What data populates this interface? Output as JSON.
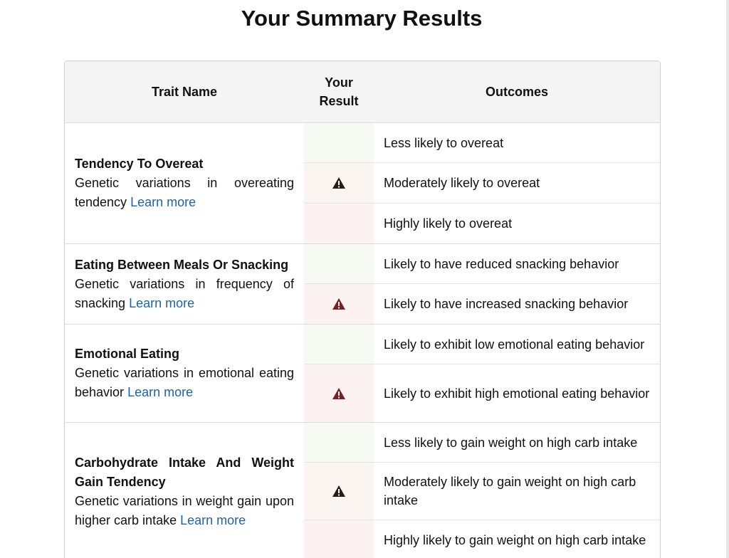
{
  "page_title": "Your Summary Results",
  "columns": {
    "trait": "Trait Name",
    "result_line1": "Your",
    "result_line2": "Result",
    "outcomes": "Outcomes"
  },
  "learn_more_label": "Learn more",
  "colors": {
    "warning_dark": "#2b1a0e",
    "warning_red": "#7a1f1f",
    "link": "#1f63a8"
  },
  "traits": [
    {
      "name": "Tendency To Overeat",
      "description": "Genetic variations in overeating tendency",
      "outcomes": [
        {
          "text": "Less likely to overeat",
          "marked": false
        },
        {
          "text": "Moderately likely to overeat",
          "marked": true,
          "icon": "warning-icon"
        },
        {
          "text": "Highly likely to overeat",
          "marked": false
        }
      ]
    },
    {
      "name": "Eating Between Meals Or Snacking",
      "description": "Genetic variations in frequency of snacking",
      "outcomes": [
        {
          "text": "Likely to have reduced snacking behavior",
          "marked": false
        },
        {
          "text": "Likely to have increased snacking behavior",
          "marked": true,
          "icon": "warning-icon"
        }
      ]
    },
    {
      "name": "Emotional Eating",
      "description": "Genetic variations in emotional eating behavior",
      "outcomes": [
        {
          "text": "Likely to exhibit low emotional eating behavior",
          "marked": false
        },
        {
          "text": "Likely to exhibit high emotional eating behavior",
          "marked": true,
          "icon": "warning-icon"
        }
      ]
    },
    {
      "name": "Carbohydrate Intake And Weight Gain Tendency",
      "description": "Genetic variations in weight gain upon higher carb intake",
      "outcomes": [
        {
          "text": "Less likely to gain weight on high carb intake",
          "marked": false
        },
        {
          "text": "Moderately likely to gain weight on high carb intake",
          "marked": true,
          "icon": "warning-icon"
        },
        {
          "text": "Highly likely to gain weight on high carb intake",
          "marked": false
        }
      ]
    }
  ]
}
